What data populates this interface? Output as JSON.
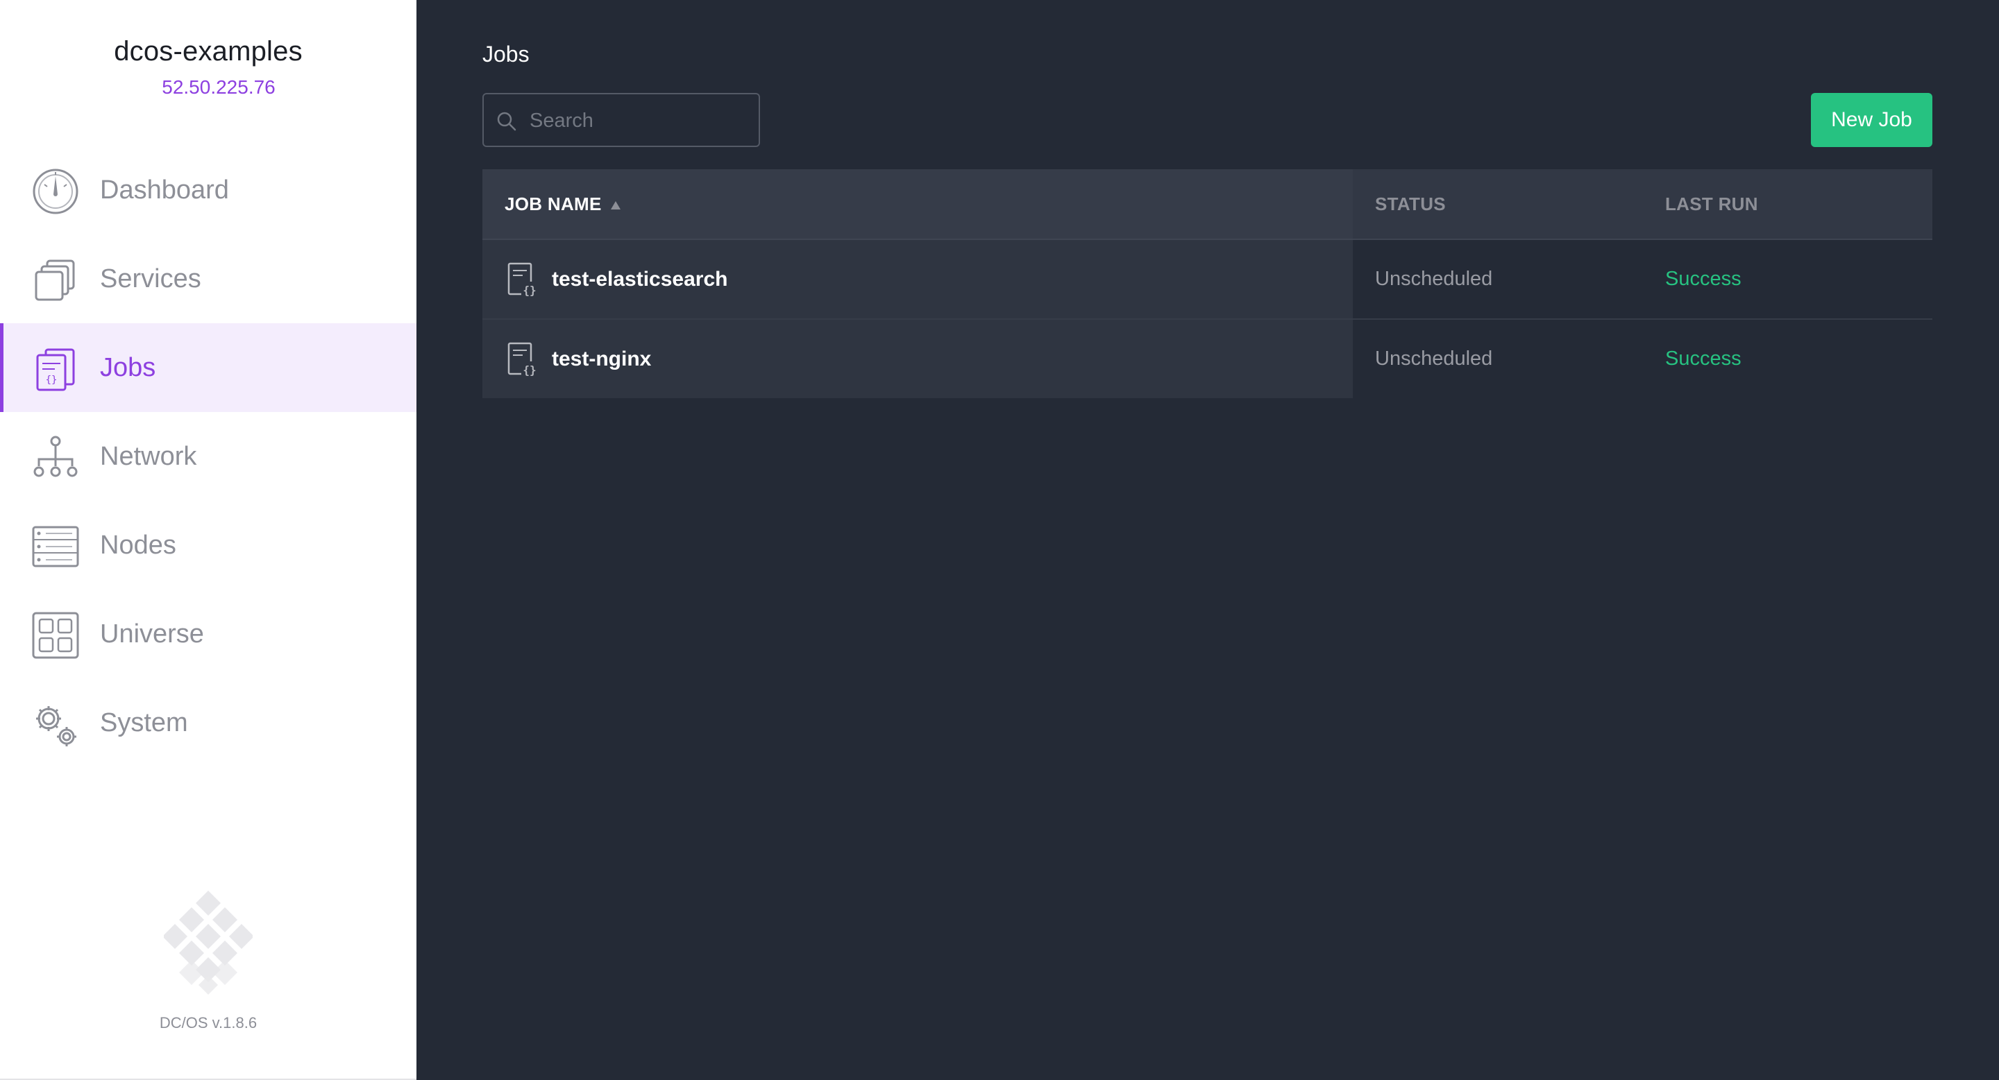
{
  "sidebar": {
    "cluster_name": "dcos-examples",
    "cluster_ip": "52.50.225.76",
    "items": [
      {
        "label": "Dashboard",
        "icon": "dashboard-gauge-icon",
        "active": false
      },
      {
        "label": "Services",
        "icon": "services-stack-icon",
        "active": false
      },
      {
        "label": "Jobs",
        "icon": "jobs-document-icon",
        "active": true
      },
      {
        "label": "Network",
        "icon": "network-tree-icon",
        "active": false
      },
      {
        "label": "Nodes",
        "icon": "nodes-server-icon",
        "active": false
      },
      {
        "label": "Universe",
        "icon": "universe-grid-icon",
        "active": false
      },
      {
        "label": "System",
        "icon": "system-gears-icon",
        "active": false
      }
    ],
    "version": "DC/OS v.1.8.6"
  },
  "main": {
    "title": "Jobs",
    "search": {
      "placeholder": "Search",
      "value": ""
    },
    "new_job_label": "New Job"
  },
  "table": {
    "columns": {
      "job_name": "JOB NAME",
      "status": "STATUS",
      "last_run": "LAST RUN"
    },
    "sort": {
      "column": "job_name",
      "direction": "ascending"
    },
    "rows": [
      {
        "name": "test-elasticsearch",
        "status": "Unscheduled",
        "last_run": "Success"
      },
      {
        "name": "test-nginx",
        "status": "Unscheduled",
        "last_run": "Success"
      }
    ]
  },
  "colors": {
    "accent": "#8d40e0",
    "success": "#27c281",
    "button": "#26c281",
    "main_bg": "#242a36"
  }
}
